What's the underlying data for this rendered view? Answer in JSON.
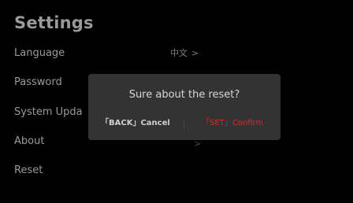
{
  "settings": {
    "title": "Settings",
    "items": [
      {
        "label": "Language",
        "value": "中文",
        "chevron": ">"
      },
      {
        "label": "Password"
      },
      {
        "label": "System Upda"
      },
      {
        "label": "About",
        "chevron": ">"
      },
      {
        "label": "Reset"
      }
    ]
  },
  "dialog": {
    "message": "Sure about the reset?",
    "cancel_label": "「BACK」Cancel",
    "confirm_label": "「SET」Confirm"
  },
  "colors": {
    "background": "#000000",
    "text": "#9a9a9a",
    "dialog_background": "#333333",
    "confirm_accent": "#d62b2b"
  }
}
